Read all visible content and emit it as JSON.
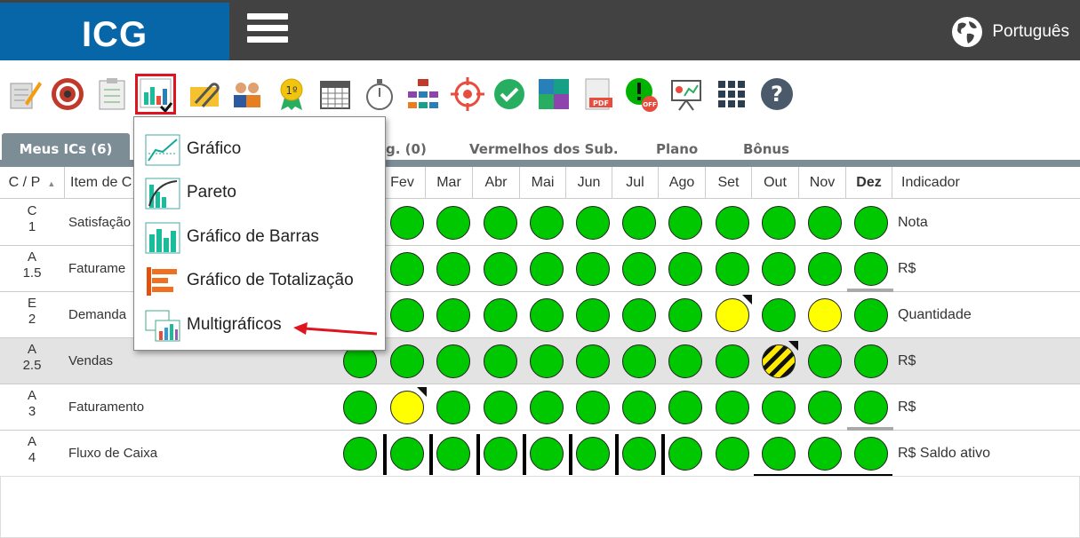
{
  "header": {
    "logo": "ICG",
    "language": "Português"
  },
  "tabs": [
    {
      "label": "Meus ICs (6)",
      "active": true
    },
    {
      "label": "g. (0)"
    },
    {
      "label": "Vermelhos dos Sub."
    },
    {
      "label": "Plano"
    },
    {
      "label": "Bônus"
    }
  ],
  "table": {
    "headers": {
      "cp": "C / P",
      "item": "Item de C",
      "months": [
        "Fev",
        "Mar",
        "Abr",
        "Mai",
        "Jun",
        "Jul",
        "Ago",
        "Set",
        "Out",
        "Nov",
        "Dez"
      ],
      "indicator": "Indicador"
    },
    "rows": [
      {
        "cls": "C",
        "prio": "1",
        "item": "Satisfação",
        "indicator": "Nota"
      },
      {
        "cls": "A",
        "prio": "1.5",
        "item": "Faturame",
        "indicator": "R$"
      },
      {
        "cls": "E",
        "prio": "2",
        "item": "Demanda",
        "indicator": "Quantidade"
      },
      {
        "cls": "A",
        "prio": "2.5",
        "item": "Vendas",
        "indicator": "R$"
      },
      {
        "cls": "A",
        "prio": "3",
        "item": "Faturamento",
        "indicator": "R$"
      },
      {
        "cls": "A",
        "prio": "4",
        "item": "Fluxo de Caixa",
        "indicator": "R$ Saldo ativo"
      }
    ]
  },
  "dropdown": {
    "items": [
      "Gráfico",
      "Pareto",
      "Gráfico de Barras",
      "Gráfico de Totalização",
      "Multigráficos"
    ]
  },
  "status_colors": {
    "green": "#00c800",
    "yellow": "#ffff00",
    "critical": "striped yellow/black"
  }
}
